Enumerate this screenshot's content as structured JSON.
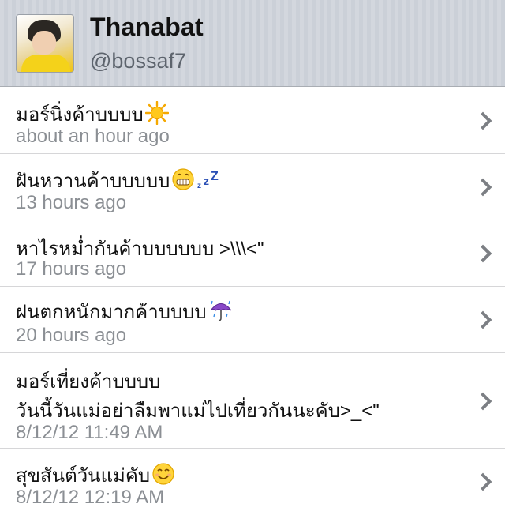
{
  "profile": {
    "name": "Thanabat",
    "handle": "@bossaf7"
  },
  "tweets": [
    {
      "text": "มอร์นิ่งค้าบบบบ",
      "emoji": "sun-icon",
      "time": "about an hour ago"
    },
    {
      "text": "ฝันหวานค้าบบบบบ",
      "emoji": "grin-sleep-icon",
      "time": "13 hours ago"
    },
    {
      "text": "หาไรหม่ำกันค้าบบบบบบ >\\\\\\<\"",
      "time": "17 hours ago"
    },
    {
      "text": "ฝนตกหนักมากค้าบบบบ",
      "emoji": "umbrella-rain-icon",
      "time": "20 hours ago"
    },
    {
      "text": "มอร์เที่ยงค้าบบบบ",
      "text2": "วันนี้วันแม่อย่าลืมพาแม่ไปเที่ยวกันนะคับ>_<\"",
      "time": "8/12/12 11:49 AM"
    },
    {
      "text": "สุขสันต์วันแม่คับ",
      "emoji": "smile-icon",
      "time": "8/12/12 12:19 AM"
    }
  ],
  "colors": {
    "header_bg": "#cfd3da",
    "time_text": "#8b8f94",
    "chevron": "#7c7f84",
    "separator": "#d6d6d8"
  }
}
